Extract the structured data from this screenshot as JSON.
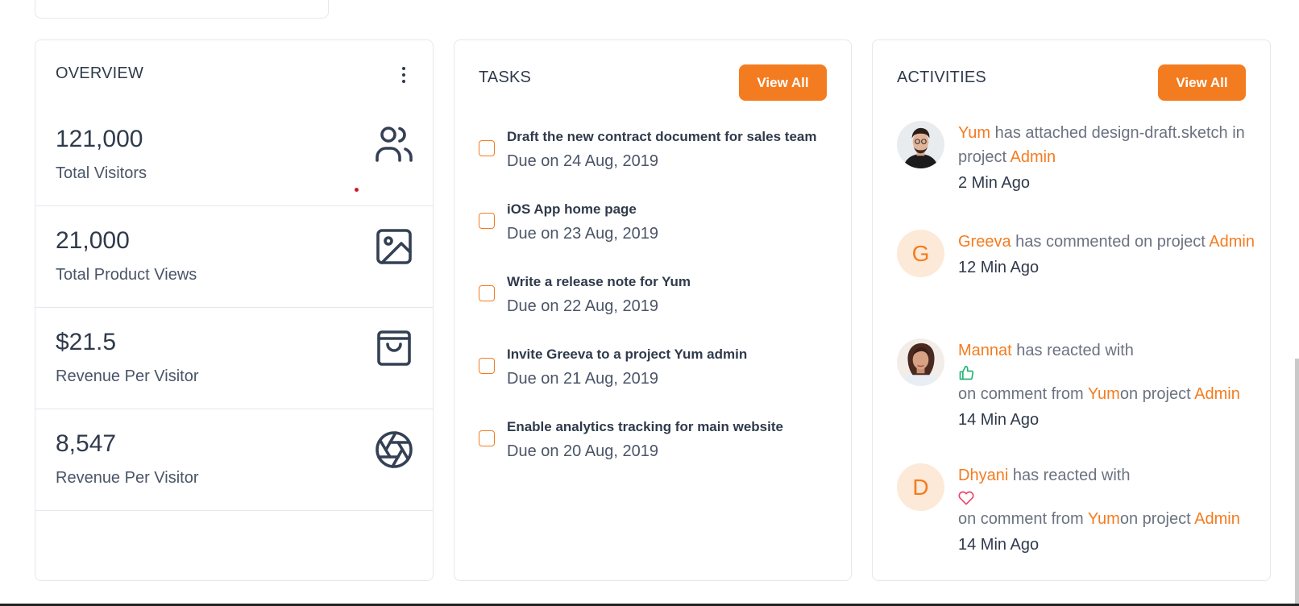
{
  "overview": {
    "title": "OVERVIEW",
    "stats": [
      {
        "value": "121,000",
        "label": "Total Visitors",
        "icon": "users-icon"
      },
      {
        "value": "21,000",
        "label": "Total Product Views",
        "icon": "image-icon"
      },
      {
        "value": "$21.5",
        "label": "Revenue Per Visitor",
        "icon": "shopping-bag-icon"
      },
      {
        "value": "8,547",
        "label": "Revenue Per Visitor",
        "icon": "aperture-icon"
      }
    ]
  },
  "tasks": {
    "title": "TASKS",
    "view_all": "View All",
    "items": [
      {
        "title": "Draft the new contract document for sales team",
        "due": "Due on 24 Aug, 2019"
      },
      {
        "title": "iOS App home page",
        "due": "Due on 23 Aug, 2019"
      },
      {
        "title": "Write a release note for Yum",
        "due": "Due on 22 Aug, 2019"
      },
      {
        "title": "Invite Greeva to a project Yum admin",
        "due": "Due on 21 Aug, 2019"
      },
      {
        "title": "Enable analytics tracking for main website",
        "due": "Due on 20 Aug, 2019"
      }
    ]
  },
  "activities": {
    "title": "ACTIVITIES",
    "view_all": "View All",
    "items": [
      {
        "user": "Yum",
        "text": " has attached design-draft.sketch in project ",
        "target": "Admin",
        "time": "2 Min Ago"
      },
      {
        "user": "Greeva",
        "avatar_letter": "G",
        "text": " has commented on project ",
        "target": "Admin",
        "time": "12 Min Ago"
      },
      {
        "user": "Mannat",
        "text": " has reacted with",
        "reaction": "thumbs-up-icon",
        "on_text": "on comment from ",
        "comment_user": "Yum",
        "on_project": "on project ",
        "target": "Admin",
        "time": "14 Min Ago"
      },
      {
        "user": "Dhyani",
        "avatar_letter": "D",
        "text": " has reacted with",
        "reaction": "heart-icon",
        "on_text": "on comment from ",
        "comment_user": "Yum",
        "on_project": "on project ",
        "target": "Admin",
        "time": "14 Min Ago"
      }
    ]
  },
  "colors": {
    "accent": "#f47c20",
    "text_dark": "#2f3a4b",
    "text_muted": "#6b7280",
    "border": "#e4e7ec",
    "thumbs_up": "#22b573",
    "heart": "#f0446a"
  }
}
